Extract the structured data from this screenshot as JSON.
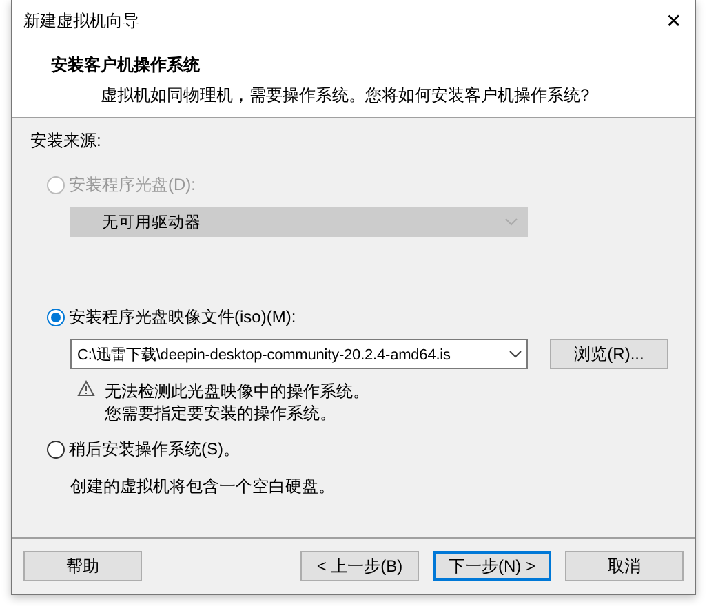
{
  "window": {
    "title": "新建虚拟机向导",
    "close": "✕"
  },
  "header": {
    "title": "安装客户机操作系统",
    "subtitle": "虚拟机如同物理机，需要操作系统。您将如何安装客户机操作系统?"
  },
  "source_label": "安装来源:",
  "options": [
    {
      "kind": "disc",
      "label": "安装程序光盘(D):",
      "selected": false,
      "disabled": true,
      "dropdown": {
        "value": "无可用驱动器",
        "disabled": true
      }
    },
    {
      "kind": "image",
      "label": "安装程序光盘映像文件(iso)(M):",
      "selected": true,
      "disabled": false,
      "combo": {
        "value": "C:\\迅雷下载\\deepin-desktop-community-20.2.4-amd64.is"
      },
      "browse": "浏览(R)...",
      "warning": [
        "无法检测此光盘映像中的操作系统。",
        "您需要指定要安装的操作系统。"
      ]
    },
    {
      "kind": "later",
      "label": "稍后安装操作系统(S)。",
      "selected": false,
      "disabled": false,
      "note": "创建的虚拟机将包含一个空白硬盘。"
    }
  ],
  "buttons": [
    {
      "label": "帮助",
      "kind": "help",
      "default": false
    },
    {
      "label": "< 上一步(B)",
      "kind": "nav",
      "default": false
    },
    {
      "label": "下一步(N) >",
      "kind": "nav",
      "default": true
    },
    {
      "label": "取消",
      "kind": "nav",
      "default": false
    }
  ]
}
